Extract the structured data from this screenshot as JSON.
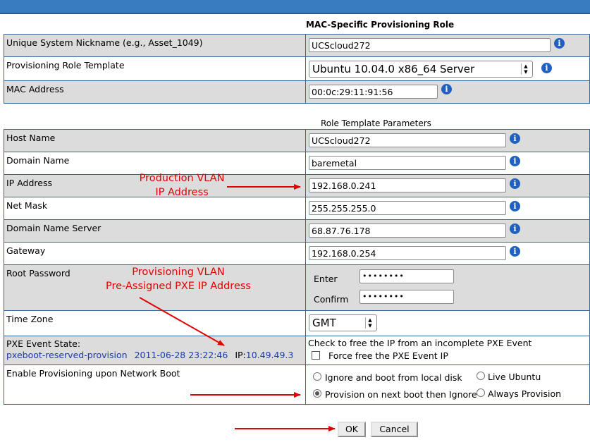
{
  "section1_title": "MAC-Specific Provisioning Role",
  "section2_title": "Role Template Parameters",
  "fields": {
    "nickname": {
      "label": "Unique System Nickname (e.g., Asset_1049)",
      "value": "UCScloud272"
    },
    "template": {
      "label": "Provisioning Role Template",
      "value": "Ubuntu 10.04.0 x86_64 Server"
    },
    "mac": {
      "label": "MAC Address",
      "value": "00:0c:29:11:91:56"
    },
    "hostname": {
      "label": "Host Name",
      "value": "UCScloud272"
    },
    "domain": {
      "label": "Domain Name",
      "value": "baremetal"
    },
    "ip": {
      "label": "IP Address",
      "value": "192.168.0.241"
    },
    "netmask": {
      "label": "Net Mask",
      "value": "255.255.255.0"
    },
    "dns": {
      "label": "Domain Name Server",
      "value": "68.87.76.178"
    },
    "gateway": {
      "label": "Gateway",
      "value": "192.168.0.254"
    },
    "rootpw": {
      "label": "Root Password",
      "enter_label": "Enter",
      "confirm_label": "Confirm",
      "enter_value": "••••••••",
      "confirm_value": "••••••••"
    },
    "timezone": {
      "label": "Time Zone",
      "value": "GMT"
    },
    "pxe": {
      "label": "PXE Event State:",
      "event": "pxeboot-reserved-provision",
      "timestamp": "2011-06-28 23:22:46",
      "ip_prefix": "IP:",
      "ip": "10.49.49.3",
      "free_hint": "Check to free the IP from an incomplete PXE Event",
      "force_label": "Force free the PXE Event IP"
    },
    "enable": {
      "label": "Enable Provisioning upon Network Boot",
      "options": [
        "Ignore and boot from local disk",
        "Live Ubuntu",
        "Provision on next boot then Ignore",
        "Always Provision"
      ],
      "selected": "Provision on next boot then Ignore"
    }
  },
  "annotations": {
    "prod_vlan_line1": "Production VLAN",
    "prod_vlan_line2": "IP Address",
    "prov_vlan_line1": "Provisioning VLAN",
    "prov_vlan_line2": "Pre-Assigned PXE IP Address"
  },
  "buttons": {
    "ok": "OK",
    "cancel": "Cancel"
  },
  "colors": {
    "annotation": "#e00000",
    "border": "#336699",
    "row_gray": "#dcdcdc",
    "topbar": "#3a7cc0"
  },
  "icons": {
    "info": "info-icon"
  }
}
